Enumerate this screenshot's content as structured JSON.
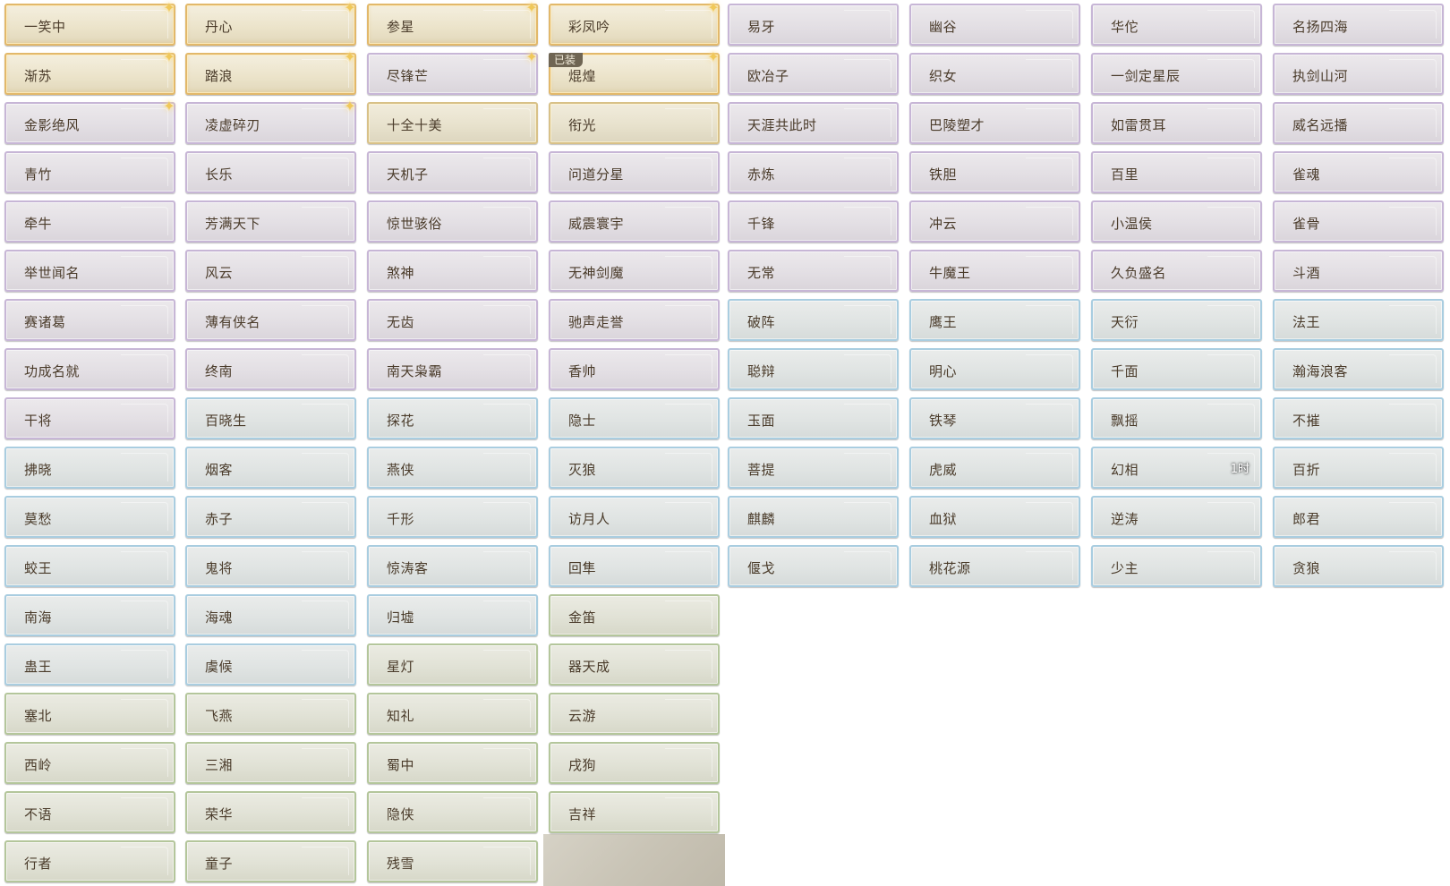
{
  "colors": {
    "gold_border": "#e2b86a",
    "gold_plain_border": "#d8c188",
    "purple_border": "#c7b6d6",
    "blue_border": "#a9cde0",
    "green_border": "#b4c69b",
    "text": "#4a3b2a",
    "sparkle": "#f0c85a",
    "badge_bg": "#6f6553"
  },
  "icons": {
    "sparkle": "sparkle-icon"
  },
  "cards": [
    {
      "label": "一笑中",
      "tier": "goldfx",
      "sparkle": true
    },
    {
      "label": "丹心",
      "tier": "goldfx",
      "sparkle": true
    },
    {
      "label": "参星",
      "tier": "goldfx",
      "sparkle": true
    },
    {
      "label": "彩凤吟",
      "tier": "goldfx",
      "sparkle": true
    },
    {
      "label": "易牙",
      "tier": "purple"
    },
    {
      "label": "幽谷",
      "tier": "purple"
    },
    {
      "label": "华佗",
      "tier": "purple"
    },
    {
      "label": "名扬四海",
      "tier": "purple"
    },
    {
      "label": "渐苏",
      "tier": "goldfx",
      "sparkle": true
    },
    {
      "label": "踏浪",
      "tier": "goldfx",
      "sparkle": true
    },
    {
      "label": "尽锋芒",
      "tier": "purple",
      "sparkle": true
    },
    {
      "label": "焜煌",
      "tier": "goldfx",
      "sparkle": true,
      "badge": "已装"
    },
    {
      "label": "欧冶子",
      "tier": "purple"
    },
    {
      "label": "织女",
      "tier": "purple"
    },
    {
      "label": "一剑定星辰",
      "tier": "purple"
    },
    {
      "label": "执剑山河",
      "tier": "purple"
    },
    {
      "label": "金影绝风",
      "tier": "purple",
      "sparkle": true
    },
    {
      "label": "凌虚碎刃",
      "tier": "purple",
      "sparkle": true
    },
    {
      "label": "十全十美",
      "tier": "gold"
    },
    {
      "label": "衔光",
      "tier": "gold"
    },
    {
      "label": "天涯共此时",
      "tier": "purple"
    },
    {
      "label": "巴陵塑才",
      "tier": "purple"
    },
    {
      "label": "如雷贯耳",
      "tier": "purple"
    },
    {
      "label": "威名远播",
      "tier": "purple"
    },
    {
      "label": "青竹",
      "tier": "purple"
    },
    {
      "label": "长乐",
      "tier": "purple"
    },
    {
      "label": "天机子",
      "tier": "purple"
    },
    {
      "label": "问道分星",
      "tier": "purple"
    },
    {
      "label": "赤炼",
      "tier": "purple"
    },
    {
      "label": "铁胆",
      "tier": "purple"
    },
    {
      "label": "百里",
      "tier": "purple"
    },
    {
      "label": "雀魂",
      "tier": "purple"
    },
    {
      "label": "牵牛",
      "tier": "purple"
    },
    {
      "label": "芳满天下",
      "tier": "purple"
    },
    {
      "label": "惊世骇俗",
      "tier": "purple"
    },
    {
      "label": "威震寰宇",
      "tier": "purple"
    },
    {
      "label": "千锋",
      "tier": "purple"
    },
    {
      "label": "冲云",
      "tier": "purple"
    },
    {
      "label": "小温侯",
      "tier": "purple"
    },
    {
      "label": "雀骨",
      "tier": "purple"
    },
    {
      "label": "举世闻名",
      "tier": "purple"
    },
    {
      "label": "风云",
      "tier": "purple"
    },
    {
      "label": "煞神",
      "tier": "purple"
    },
    {
      "label": "无神剑魔",
      "tier": "purple"
    },
    {
      "label": "无常",
      "tier": "purple"
    },
    {
      "label": "牛魔王",
      "tier": "purple"
    },
    {
      "label": "久负盛名",
      "tier": "purple"
    },
    {
      "label": "斗酒",
      "tier": "purple"
    },
    {
      "label": "赛诸葛",
      "tier": "purple"
    },
    {
      "label": "薄有侠名",
      "tier": "purple"
    },
    {
      "label": "无齿",
      "tier": "purple"
    },
    {
      "label": "驰声走誉",
      "tier": "purple"
    },
    {
      "label": "破阵",
      "tier": "blue"
    },
    {
      "label": "鹰王",
      "tier": "blue"
    },
    {
      "label": "天衍",
      "tier": "blue"
    },
    {
      "label": "法王",
      "tier": "blue"
    },
    {
      "label": "功成名就",
      "tier": "purple"
    },
    {
      "label": "终南",
      "tier": "purple"
    },
    {
      "label": "南天枭霸",
      "tier": "purple"
    },
    {
      "label": "香帅",
      "tier": "purple"
    },
    {
      "label": "聪辩",
      "tier": "blue"
    },
    {
      "label": "明心",
      "tier": "blue"
    },
    {
      "label": "千面",
      "tier": "blue"
    },
    {
      "label": "瀚海浪客",
      "tier": "blue"
    },
    {
      "label": "干将",
      "tier": "purple"
    },
    {
      "label": "百晓生",
      "tier": "blue"
    },
    {
      "label": "探花",
      "tier": "blue"
    },
    {
      "label": "隐士",
      "tier": "blue"
    },
    {
      "label": "玉面",
      "tier": "blue"
    },
    {
      "label": "铁琴",
      "tier": "blue"
    },
    {
      "label": "飘摇",
      "tier": "blue"
    },
    {
      "label": "不摧",
      "tier": "blue"
    },
    {
      "label": "拂晓",
      "tier": "blue"
    },
    {
      "label": "烟客",
      "tier": "blue"
    },
    {
      "label": "燕侠",
      "tier": "blue"
    },
    {
      "label": "灭狼",
      "tier": "blue"
    },
    {
      "label": "菩提",
      "tier": "blue"
    },
    {
      "label": "虎威",
      "tier": "blue"
    },
    {
      "label": "幻相",
      "tier": "blue",
      "timer": "1时"
    },
    {
      "label": "百折",
      "tier": "blue"
    },
    {
      "label": "莫愁",
      "tier": "blue"
    },
    {
      "label": "赤子",
      "tier": "blue"
    },
    {
      "label": "千形",
      "tier": "blue"
    },
    {
      "label": "访月人",
      "tier": "blue"
    },
    {
      "label": "麒麟",
      "tier": "blue"
    },
    {
      "label": "血狱",
      "tier": "blue"
    },
    {
      "label": "逆涛",
      "tier": "blue"
    },
    {
      "label": "郎君",
      "tier": "blue"
    },
    {
      "label": "蛟王",
      "tier": "blue"
    },
    {
      "label": "鬼将",
      "tier": "blue"
    },
    {
      "label": "惊涛客",
      "tier": "blue"
    },
    {
      "label": "回隼",
      "tier": "blue"
    },
    {
      "label": "偃戈",
      "tier": "blue"
    },
    {
      "label": "桃花源",
      "tier": "blue"
    },
    {
      "label": "少主",
      "tier": "blue"
    },
    {
      "label": "贪狼",
      "tier": "blue"
    },
    {
      "label": "南海",
      "tier": "blue"
    },
    {
      "label": "海魂",
      "tier": "blue"
    },
    {
      "label": "归墟",
      "tier": "blue"
    },
    {
      "label": "金笛",
      "tier": "green"
    },
    {
      "label": "蛊王",
      "tier": "blue"
    },
    {
      "label": "虞候",
      "tier": "blue"
    },
    {
      "label": "星灯",
      "tier": "green"
    },
    {
      "label": "器天成",
      "tier": "green"
    },
    {
      "label": "塞北",
      "tier": "green"
    },
    {
      "label": "飞燕",
      "tier": "green"
    },
    {
      "label": "知礼",
      "tier": "green"
    },
    {
      "label": "云游",
      "tier": "green"
    },
    {
      "label": "西岭",
      "tier": "green"
    },
    {
      "label": "三湘",
      "tier": "green"
    },
    {
      "label": "蜀中",
      "tier": "green"
    },
    {
      "label": "戌狗",
      "tier": "green"
    },
    {
      "label": "不语",
      "tier": "green"
    },
    {
      "label": "荣华",
      "tier": "green"
    },
    {
      "label": "隐侠",
      "tier": "green"
    },
    {
      "label": "吉祥",
      "tier": "green"
    },
    {
      "label": "行者",
      "tier": "green"
    },
    {
      "label": "童子",
      "tier": "green"
    },
    {
      "label": "残雪",
      "tier": "green"
    }
  ]
}
